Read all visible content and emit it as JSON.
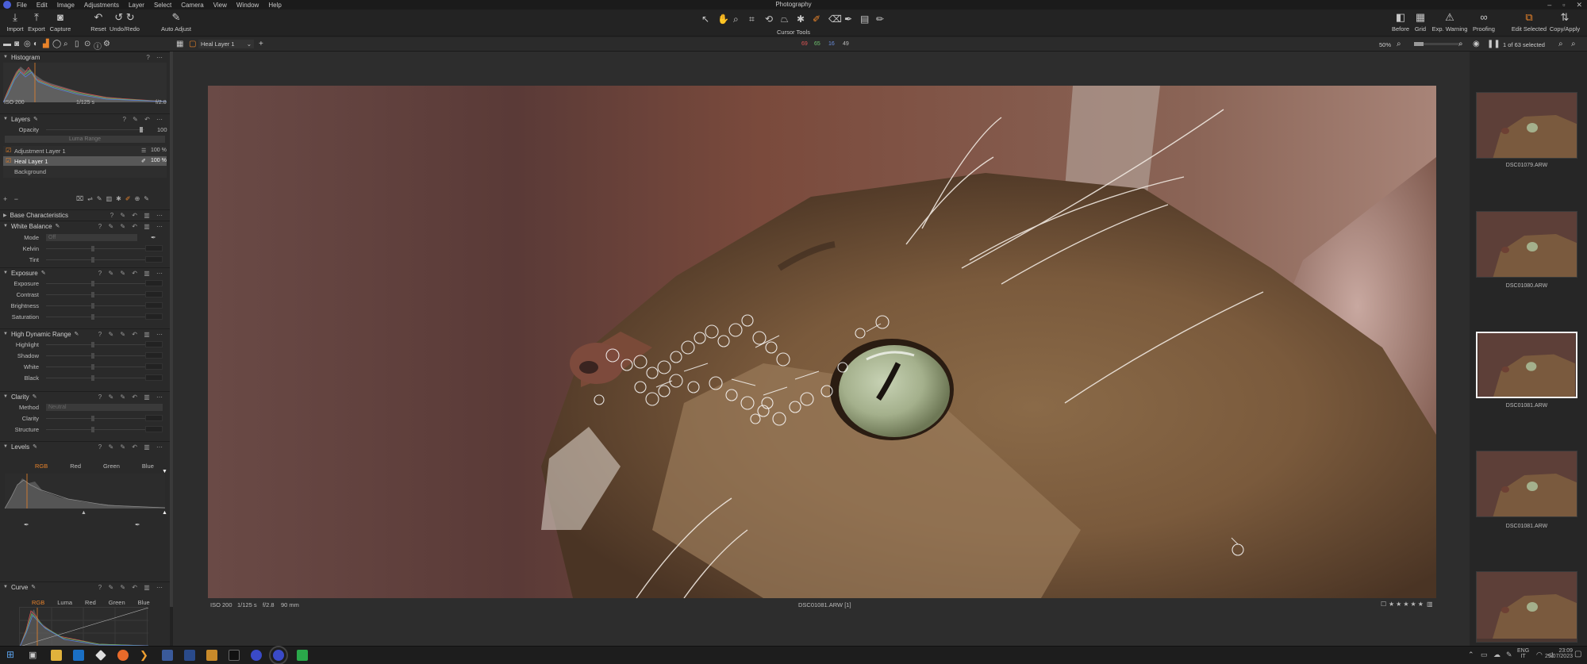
{
  "window": {
    "title": "Photography"
  },
  "menu": [
    "File",
    "Edit",
    "Image",
    "Adjustments",
    "Layer",
    "Select",
    "Camera",
    "View",
    "Window",
    "Help"
  ],
  "toolbar": {
    "left": [
      {
        "label": "Import",
        "icon": "import-icon"
      },
      {
        "label": "Export",
        "icon": "export-icon"
      },
      {
        "label": "Capture",
        "icon": "camera-icon"
      },
      {
        "label": "Reset",
        "icon": "reset-icon"
      },
      {
        "label": "Undo/Redo",
        "icon": "undo-icon"
      },
      {
        "label": "Auto Adjust",
        "icon": "wand-icon"
      }
    ],
    "cursor_tools_label": "Cursor Tools",
    "right": [
      {
        "label": "Before",
        "icon": "before-icon"
      },
      {
        "label": "Grid",
        "icon": "grid-icon"
      },
      {
        "label": "Exp. Warning",
        "icon": "warning-icon"
      },
      {
        "label": "Proofing",
        "icon": "proofing-icon"
      },
      {
        "label": "Edit Selected",
        "icon": "edit-selected-icon"
      },
      {
        "label": "Copy/Apply",
        "icon": "copy-apply-icon"
      }
    ]
  },
  "bar2": {
    "layer_select": "Heal Layer 1",
    "counts": {
      "red": "69",
      "green": "65",
      "blue": "16",
      "gray": "49"
    },
    "zoom": "50%",
    "selection": "1 of 63 selected"
  },
  "histogram": {
    "title": "Histogram",
    "iso": "ISO 200",
    "shutter": "1/125 s",
    "aperture": "f/2.8"
  },
  "layers": {
    "title": "Layers",
    "opacity_label": "Opacity",
    "opacity_value": "100",
    "luma_range": "Luma Range",
    "items": [
      {
        "name": "Adjustment Layer 1",
        "value": "100 %"
      },
      {
        "name": "Heal Layer 1",
        "value": "100 %",
        "selected": true
      },
      {
        "name": "Background",
        "value": ""
      }
    ]
  },
  "panels": {
    "base": "Base Characteristics",
    "wb": {
      "title": "White Balance",
      "mode_label": "Mode",
      "mode_value": "Off",
      "kelvin": "Kelvin",
      "tint": "Tint"
    },
    "exposure": {
      "title": "Exposure",
      "rows": [
        "Exposure",
        "Contrast",
        "Brightness",
        "Saturation"
      ]
    },
    "hdr": {
      "title": "High Dynamic Range",
      "rows": [
        "Highlight",
        "Shadow",
        "White",
        "Black"
      ]
    },
    "clarity": {
      "title": "Clarity",
      "method_label": "Method",
      "method_value": "Neutral",
      "rows": [
        "Clarity",
        "Structure"
      ]
    },
    "levels": {
      "title": "Levels",
      "tabs": [
        "RGB",
        "Red",
        "Green",
        "Blue"
      ]
    },
    "curve": {
      "title": "Curve",
      "tabs": [
        "RGB",
        "Luma",
        "Red",
        "Green",
        "Blue"
      ]
    }
  },
  "viewer": {
    "iso": "ISO 200",
    "shutter": "1/125 s",
    "aperture": "f/2.8",
    "focal": "90 mm",
    "filename": "DSC01081.ARW [1]",
    "rating": "★★★★★"
  },
  "filmstrip": [
    {
      "name": "DSC01079.ARW",
      "selected": false
    },
    {
      "name": "DSC01080.ARW",
      "selected": false
    },
    {
      "name": "DSC01081.ARW",
      "selected": true
    },
    {
      "name": "DSC01081.ARW",
      "selected": false
    },
    {
      "name": "",
      "selected": false
    }
  ],
  "taskbar": {
    "lang1": "ENG",
    "lang2": "IT",
    "time": "23:09",
    "date": "29/07/2023"
  },
  "colors": {
    "accent": "#e8832a",
    "bg": "#2d2d2d",
    "panel": "#2a2a2a"
  }
}
